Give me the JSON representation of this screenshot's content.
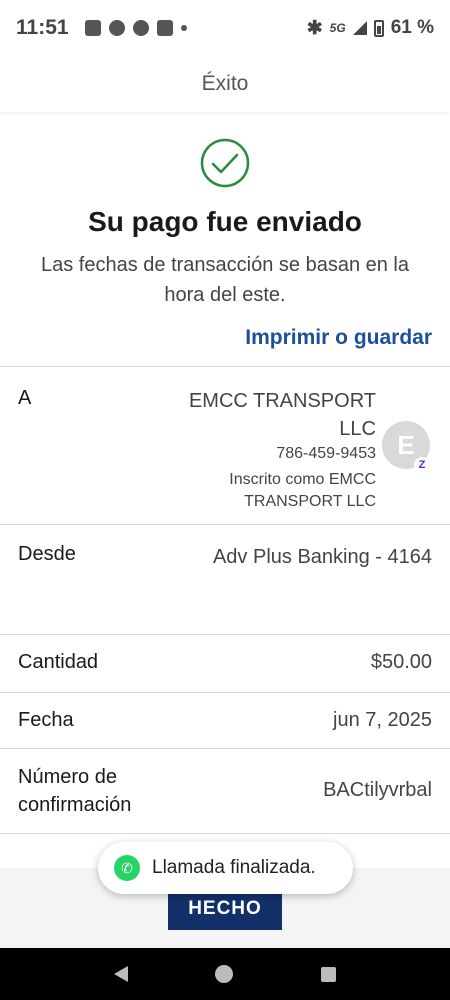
{
  "status_bar": {
    "time": "11:51",
    "network": "5G",
    "battery": "61 %"
  },
  "header": {
    "title": "Éxito"
  },
  "success": {
    "title": "Su pago fue enviado",
    "subtitle": "Las fechas de transacción se basan en la hora del este."
  },
  "print_link": "Imprimir o guardar",
  "details": {
    "to": {
      "label": "A",
      "name": "EMCC TRANSPORT LLC",
      "phone": "786-459-9453",
      "enrolled": "Inscrito como EMCC TRANSPORT LLC",
      "avatar_initial": "E",
      "badge": "Z"
    },
    "from": {
      "label": "Desde",
      "value": "Adv Plus Banking - 4164"
    },
    "amount": {
      "label": "Cantidad",
      "value": "$50.00"
    },
    "date": {
      "label": "Fecha",
      "value": "jun 7, 2025"
    },
    "confirmation": {
      "label": "Número de confirmación",
      "value": "BACtilyvrbal"
    }
  },
  "toast": {
    "text": "Llamada finalizada.",
    "icon": "whatsapp-icon"
  },
  "done_button": "HECHO",
  "colors": {
    "link": "#1c4f9c",
    "button": "#13306b",
    "success_check": "#2e8b3d"
  }
}
